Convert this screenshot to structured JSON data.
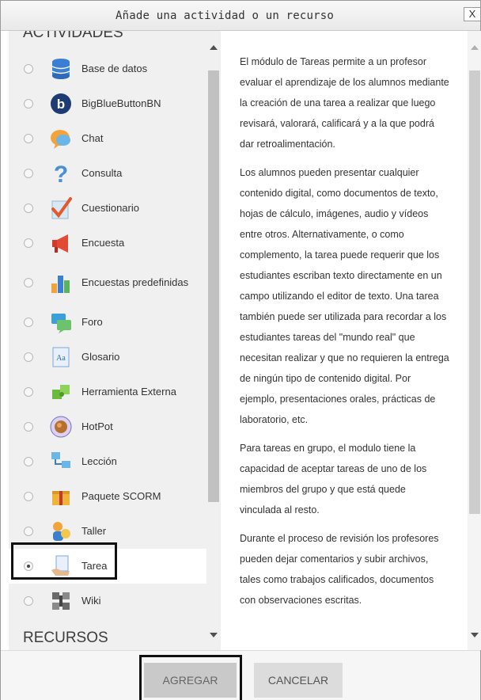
{
  "dialog": {
    "title": "Añade una actividad o un recurso",
    "close_label": "X"
  },
  "sections": {
    "activities_heading": "ACTIVIDADES",
    "resources_heading": "RECURSOS"
  },
  "activities": [
    {
      "label": "Base de datos",
      "icon": "database-icon"
    },
    {
      "label": "BigBlueButtonBN",
      "icon": "bigbluebutton-icon"
    },
    {
      "label": "Chat",
      "icon": "chat-icon"
    },
    {
      "label": "Consulta",
      "icon": "question-mark-icon"
    },
    {
      "label": "Cuestionario",
      "icon": "checkmark-icon"
    },
    {
      "label": "Encuesta",
      "icon": "megaphone-icon"
    },
    {
      "label": "Encuestas predefinidas",
      "icon": "bar-chart-icon"
    },
    {
      "label": "Foro",
      "icon": "forum-icon"
    },
    {
      "label": "Glosario",
      "icon": "glossary-icon"
    },
    {
      "label": "Herramienta Externa",
      "icon": "puzzle-icon"
    },
    {
      "label": "HotPot",
      "icon": "hotpot-icon"
    },
    {
      "label": "Lección",
      "icon": "lesson-icon"
    },
    {
      "label": "Paquete SCORM",
      "icon": "package-icon"
    },
    {
      "label": "Taller",
      "icon": "workshop-icon"
    },
    {
      "label": "Tarea",
      "icon": "assignment-icon",
      "selected": true
    },
    {
      "label": "Wiki",
      "icon": "wiki-icon"
    }
  ],
  "description": [
    "El módulo de Tareas permite a un profesor evaluar el aprendizaje de los alumnos mediante la creación de una tarea a realizar que luego revisará, valorará, calificará y a la que podrá dar retroalimentación.",
    "Los alumnos pueden presentar cualquier contenido digital, como documentos de texto, hojas de cálculo, imágenes, audio y vídeos entre otros. Alternativamente, o como complemento, la tarea puede requerir que los estudiantes escriban texto directamente en un campo utilizando el editor de texto. Una tarea también puede ser utilizada para recordar a los estudiantes tareas del \"mundo real\" que necesitan realizar y que no requieren la entrega de ningún tipo de contenido digital. Por ejemplo, presentaciones orales, prácticas de laboratorio, etc.",
    "Para tareas en grupo, el modulo tiene la capacidad de aceptar tareas de uno de los miembros del grupo y que está quede vinculada al resto.",
    "Durante el proceso de revisión los profesores pueden dejar comentarios y subir archivos, tales como trabajos calificados, documentos con observaciones escritas."
  ],
  "footer": {
    "add_label": "AGREGAR",
    "cancel_label": "CANCELAR"
  },
  "colors": {
    "selected_outline": "#111111",
    "button_bg": "#dcdcdc",
    "list_bg": "#f0f0f0"
  }
}
